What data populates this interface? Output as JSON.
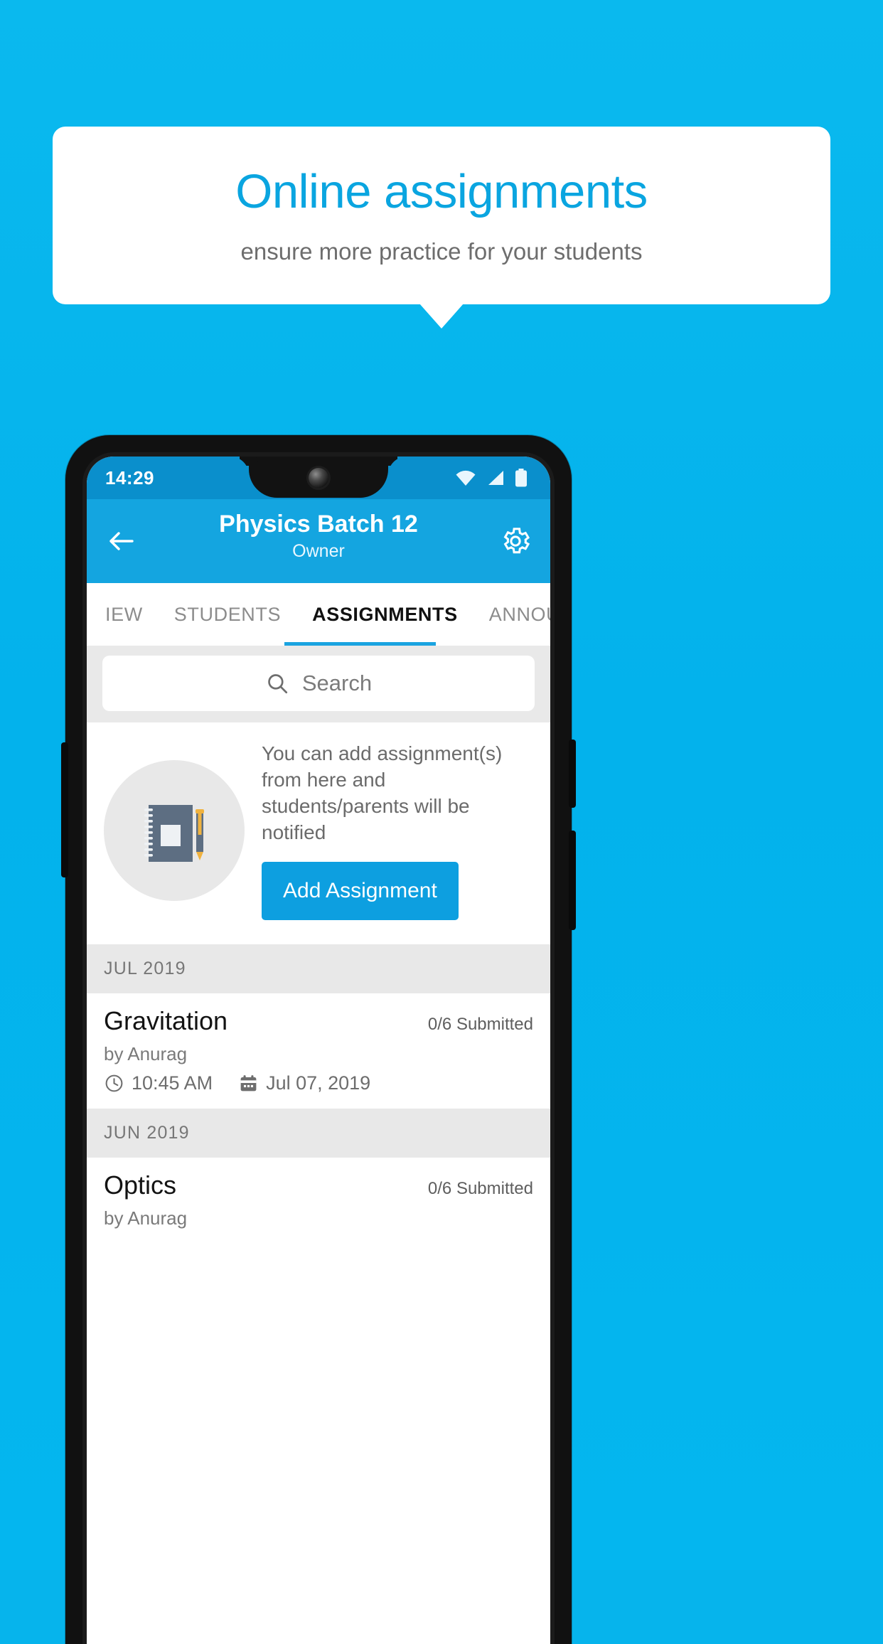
{
  "promo": {
    "title": "Online assignments",
    "subtitle": "ensure more practice for your students",
    "accent_color": "#0aa5e0",
    "background_color": "#06b4ec"
  },
  "phone": {
    "status_bar": {
      "time": "14:29",
      "icons": [
        "wifi-icon",
        "signal-icon",
        "battery-icon"
      ],
      "background_color": "#0a8fcc"
    },
    "appbar": {
      "back_icon": "back-arrow-icon",
      "title": "Physics Batch 12",
      "subtitle": "Owner",
      "settings_icon": "gear-icon",
      "background_color": "#14a5e0"
    },
    "tabs": [
      {
        "label": "IEW",
        "active": false
      },
      {
        "label": "STUDENTS",
        "active": false
      },
      {
        "label": "ASSIGNMENTS",
        "active": true
      },
      {
        "label": "ANNOUNCEM",
        "active": false
      }
    ],
    "search": {
      "placeholder": "Search",
      "value": "",
      "icon": "search-icon"
    },
    "empty_state": {
      "illustration": "notebook-and-pen-icon",
      "text": "You can add assignment(s) from here and students/parents will be notified",
      "button_label": "Add Assignment",
      "button_color": "#0d9fe0"
    },
    "sections": [
      {
        "month": "JUL 2019",
        "items": [
          {
            "title": "Gravitation",
            "submitted": "0/6 Submitted",
            "author": "by Anurag",
            "time": "10:45 AM",
            "date": "Jul 07, 2019",
            "time_icon": "clock-icon",
            "date_icon": "calendar-icon"
          }
        ]
      },
      {
        "month": "JUN 2019",
        "items": [
          {
            "title": "Optics",
            "submitted": "0/6 Submitted",
            "author": "by Anurag",
            "time": "",
            "date": "",
            "time_icon": "clock-icon",
            "date_icon": "calendar-icon"
          }
        ]
      }
    ]
  }
}
